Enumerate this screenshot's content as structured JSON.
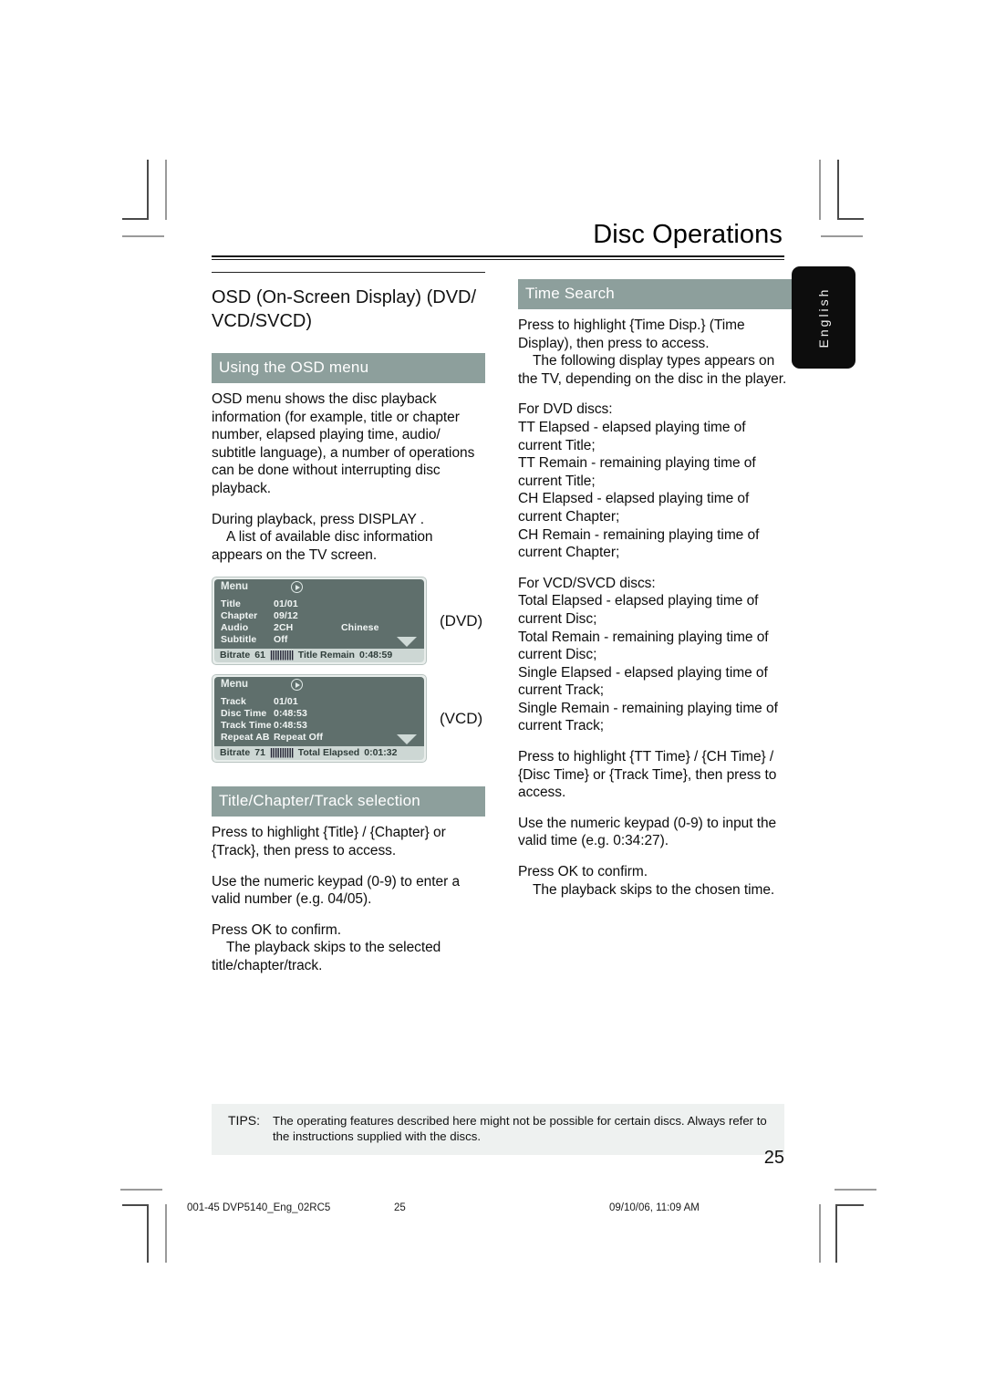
{
  "header": {
    "title": "Disc Operations",
    "language_tab": "English"
  },
  "left_column": {
    "section_title": "OSD (On-Screen Display) (DVD/ VCD/SVCD)",
    "band_osd_menu": "Using the OSD menu",
    "paragraphs": [
      "OSD menu shows the disc playback information (for example, title or chapter number, elapsed playing time, audio/ subtitle language), a number of operations can be done without interrupting disc playback.",
      "During playback, press DISPLAY .",
      "A list of available disc information appears on the TV screen."
    ],
    "osd_dvd": {
      "menu_label": "Menu",
      "caption": "(DVD)",
      "rows": [
        {
          "key": "Title",
          "value": "01/01",
          "extra": ""
        },
        {
          "key": "Chapter",
          "value": "09/12",
          "extra": ""
        },
        {
          "key": "Audio",
          "value": "2CH",
          "extra": "Chinese"
        },
        {
          "key": "Subtitle",
          "value": "Off",
          "extra": ""
        }
      ],
      "footer": {
        "bitrate_label": "Bitrate",
        "bitrate_value": "61",
        "bars": "||||||||||",
        "time_label": "Title Remain",
        "time_value": "0:48:59"
      }
    },
    "osd_vcd": {
      "menu_label": "Menu",
      "caption": "(VCD)",
      "rows": [
        {
          "key": "Track",
          "value": "01/01",
          "extra": ""
        },
        {
          "key": "Disc Time",
          "value": "0:48:53",
          "extra": ""
        },
        {
          "key": "Track Time",
          "value": "0:48:53",
          "extra": ""
        },
        {
          "key": "Repeat AB",
          "value": "Repeat Off",
          "extra": ""
        }
      ],
      "footer": {
        "bitrate_label": "Bitrate",
        "bitrate_value": "71",
        "bars": "||||||||||",
        "time_label": "Total Elapsed",
        "time_value": "0:01:32"
      }
    },
    "band_title_selection": "Title/Chapter/Track selection",
    "selection_paragraphs": [
      "Press         to highlight {Title} / {Chapter} or {Track}, then press     to access.",
      "Use the numeric keypad (0-9)  to enter a valid number (e.g. 04/05).",
      "Press OK  to confirm.",
      "The playback skips to the selected title/chapter/track."
    ]
  },
  "right_column": {
    "band_time_search": "Time Search",
    "intro_paragraphs": [
      "Press        to highlight {Time Disp.} (Time Display), then press    to access.",
      "The following display types appears on the TV, depending on the disc in the player."
    ],
    "dvd_heading": "For DVD discs:",
    "dvd_items": [
      "TT Elapsed - elapsed playing time of current Title;",
      "TT Remain - remaining playing time of current Title;",
      "CH Elapsed - elapsed playing time of current Chapter;",
      "CH Remain - remaining playing time of current Chapter;"
    ],
    "vcd_heading": "For VCD/SVCD discs:",
    "vcd_items": [
      "Total Elapsed - elapsed playing time of current Disc;",
      "Total Remain - remaining playing time of current Disc;",
      "Single Elapsed - elapsed playing time of current Track;",
      "Single Remain - remaining playing time of current Track;"
    ],
    "time_paragraphs": [
      "Press        to highlight {TT Time} / {CH Time} / {Disc Time} or {Track Time}, then press     to access.",
      "Use the numeric keypad (0-9)  to input the valid time (e.g. 0:34:27).",
      "Press OK  to confirm.",
      "The playback skips to the chosen time."
    ]
  },
  "tips": {
    "label": "TIPS:",
    "text": "The operating features described here might not be possible for certain discs.  Always refer to the instructions supplied with the discs."
  },
  "page_number": "25",
  "print_footer": {
    "file": "001-45 DVP5140_Eng_02RC5",
    "page": "25",
    "date": "09/10/06, 11:09 AM"
  },
  "colors": {
    "band": "#8d9f9c",
    "osd_panel": "#5f6f6c",
    "osd_footer": "#cdd7d4",
    "tips_bg": "#eef1f0",
    "lang_tab": "#0d0d0d"
  }
}
